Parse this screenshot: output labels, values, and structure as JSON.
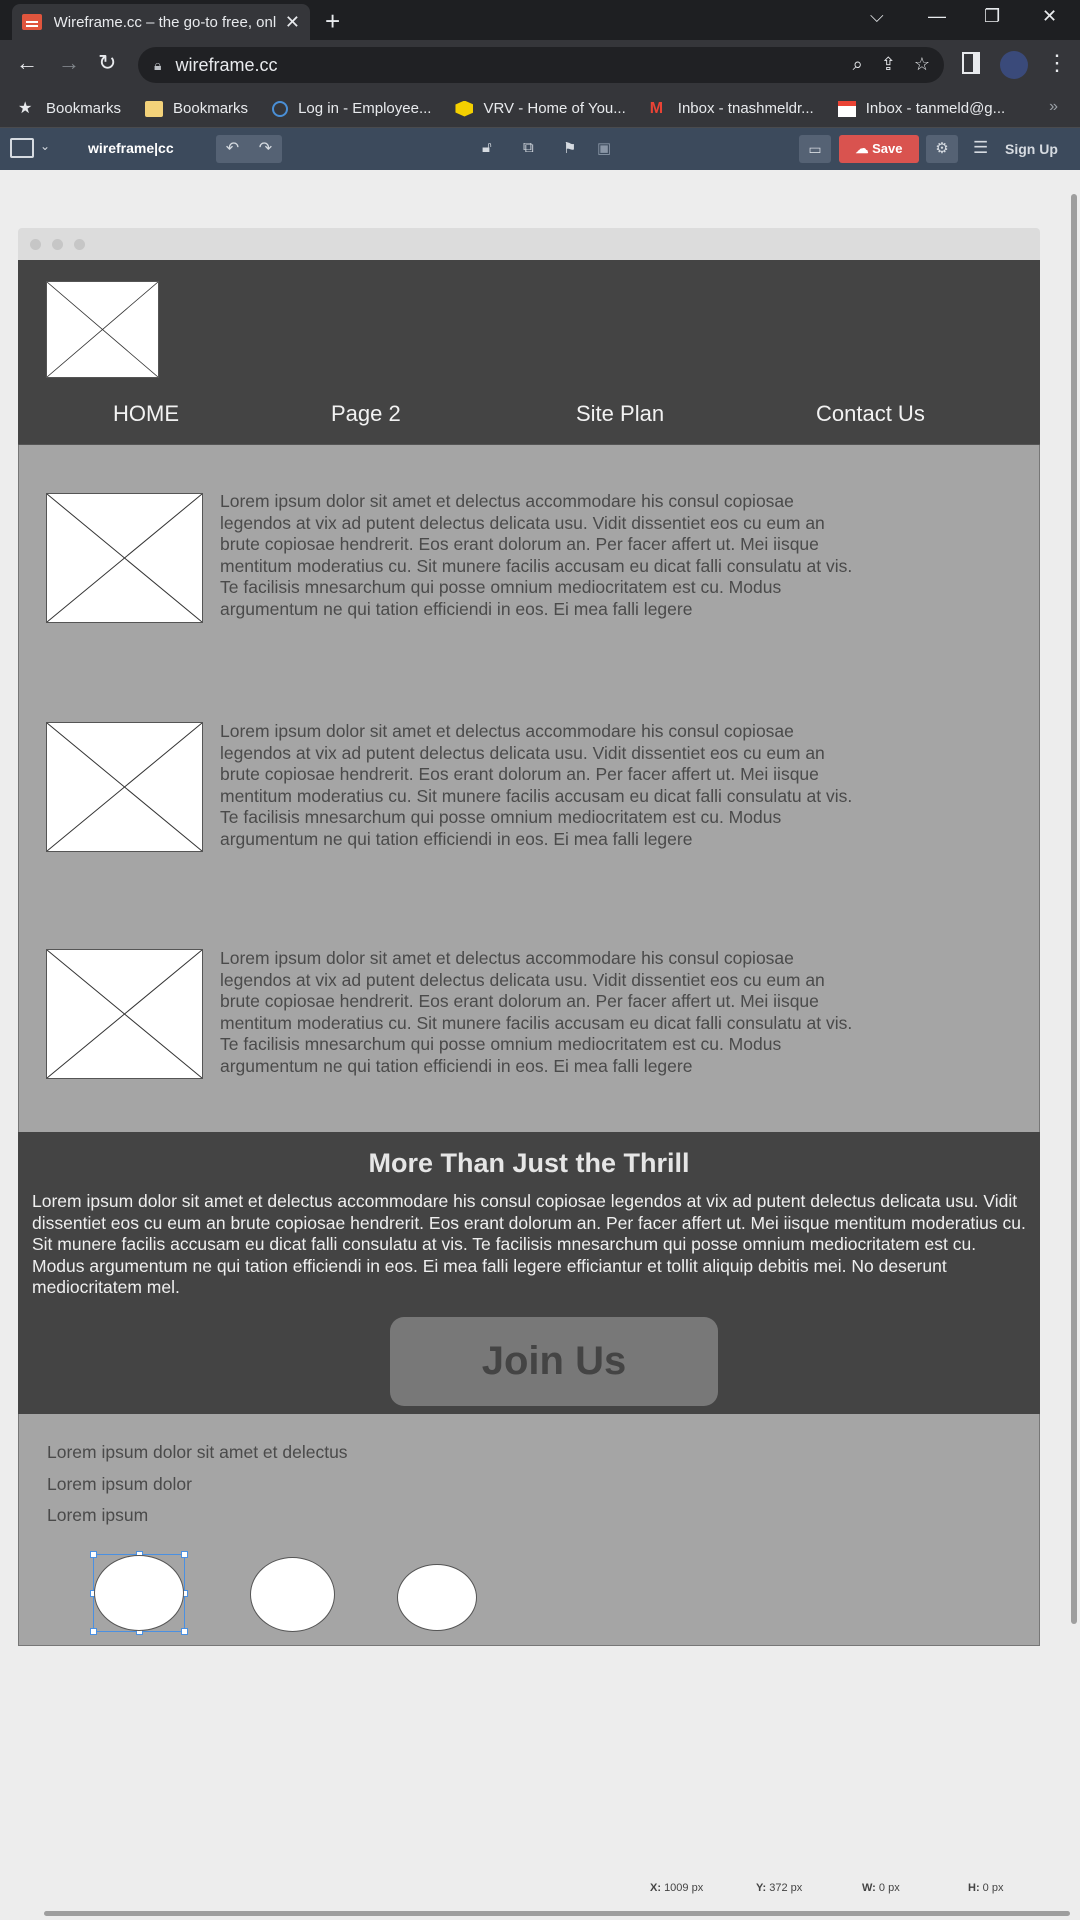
{
  "browser": {
    "tab_title": "Wireframe.cc – the go-to free, online wireframe tool",
    "url": "wireframe.cc",
    "bookmarks": [
      {
        "label": "Bookmarks",
        "icon": "star-icon"
      },
      {
        "label": "Bookmarks",
        "icon": "folder-icon"
      },
      {
        "label": "Log in - Employee...",
        "icon": "login-icon"
      },
      {
        "label": "VRV - Home of You...",
        "icon": "vrv-icon"
      },
      {
        "label": "Inbox - tnashmeldr...",
        "icon": "gmail-icon"
      },
      {
        "label": "Inbox - tanmeld@g...",
        "icon": "calendar-icon"
      }
    ]
  },
  "toolbar": {
    "brand": "wireframe|cc",
    "save_label": "Save",
    "signup_label": "Sign Up"
  },
  "wireframe": {
    "nav": [
      "HOME",
      "Page 2",
      "Site Plan",
      "Contact Us"
    ],
    "rows": [
      {
        "text": "Lorem ipsum dolor sit amet et delectus accommodare his consul copiosae legendos at vix ad putent delectus delicata usu. Vidit dissentiet eos cu eum an brute copiosae hendrerit. Eos erant dolorum an. Per facer affert ut. Mei iisque mentitum moderatius cu. Sit munere facilis accusam eu dicat falli consulatu at vis. Te facilisis mnesarchum qui posse omnium mediocritatem est cu. Modus argumentum ne qui tation efficiendi in eos. Ei mea falli legere"
      },
      {
        "text": "Lorem ipsum dolor sit amet et delectus accommodare his consul copiosae legendos at vix ad putent delectus delicata usu. Vidit dissentiet eos cu eum an brute copiosae hendrerit. Eos erant dolorum an. Per facer affert ut. Mei iisque mentitum moderatius cu. Sit munere facilis accusam eu dicat falli consulatu at vis. Te facilisis mnesarchum qui posse omnium mediocritatem est cu. Modus argumentum ne qui tation efficiendi in eos. Ei mea falli legere"
      },
      {
        "text": "Lorem ipsum dolor sit amet et delectus accommodare his consul copiosae legendos at vix ad putent delectus delicata usu. Vidit dissentiet eos cu eum an brute copiosae hendrerit. Eos erant dolorum an. Per facer affert ut. Mei iisque mentitum moderatius cu. Sit munere facilis accusam eu dicat falli consulatu at vis. Te facilisis mnesarchum qui posse omnium mediocritatem est cu. Modus argumentum ne qui tation efficiendi in eos. Ei mea falli legere"
      }
    ],
    "thrill_title": "More Than Just the Thrill",
    "thrill_text": "Lorem ipsum dolor sit amet et delectus accommodare his consul copiosae legendos at vix ad putent delectus delicata usu. Vidit dissentiet eos cu eum an brute copiosae hendrerit. Eos erant dolorum an. Per facer affert ut. Mei iisque mentitum moderatius cu. Sit munere facilis accusam eu dicat falli consulatu at vis. Te facilisis mnesarchum qui posse omnium mediocritatem est cu. Modus argumentum ne qui tation efficiendi in eos. Ei mea falli legere efficiantur et tollit aliquip debitis mei. No deserunt mediocritatem mel.",
    "join_label": "Join Us",
    "footer_lines": [
      "Lorem ipsum dolor sit amet et delectus",
      "Lorem ipsum dolor",
      "Lorem ipsum"
    ]
  },
  "statusbar": {
    "x": "1009 px",
    "y": "372 px",
    "w": "0 px",
    "h": "0 px"
  },
  "colors": {
    "save": "#d9534f",
    "toolbar": "#3c4a5c",
    "header": "#444444",
    "content": "#a5a5a5",
    "selection": "#4a90e2"
  }
}
